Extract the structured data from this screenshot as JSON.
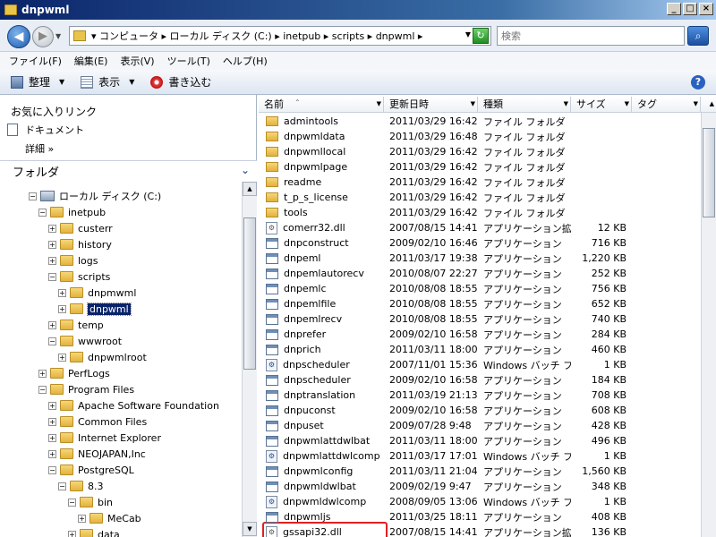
{
  "window": {
    "title": "dnpwml"
  },
  "address": {
    "path": "▾ コンピュータ ▸ ローカル ディスク (C:) ▸ inetpub ▸ scripts ▸ dnpwml ▸",
    "search_placeholder": "検索"
  },
  "menu": [
    "ファイル(F)",
    "編集(E)",
    "表示(V)",
    "ツール(T)",
    "ヘルプ(H)"
  ],
  "toolbar": {
    "organize": "整理",
    "views": "表示",
    "burn": "書き込む"
  },
  "favorites": {
    "title": "お気に入りリンク",
    "documents": "ドキュメント",
    "more": "詳細 »"
  },
  "folders_header": "フォルダ",
  "tree": [
    {
      "label": "ローカル ディスク (C:)",
      "indent": 0,
      "toggle": "−",
      "kind": "drive"
    },
    {
      "label": "inetpub",
      "indent": 1,
      "toggle": "−",
      "kind": "folder"
    },
    {
      "label": "custerr",
      "indent": 2,
      "toggle": "+",
      "kind": "folder"
    },
    {
      "label": "history",
      "indent": 2,
      "toggle": "+",
      "kind": "folder"
    },
    {
      "label": "logs",
      "indent": 2,
      "toggle": "+",
      "kind": "folder"
    },
    {
      "label": "scripts",
      "indent": 2,
      "toggle": "−",
      "kind": "folder"
    },
    {
      "label": "dnpmwml",
      "indent": 3,
      "toggle": "+",
      "kind": "folder"
    },
    {
      "label": "dnpwml",
      "indent": 3,
      "toggle": "+",
      "kind": "folder",
      "selected": true
    },
    {
      "label": "temp",
      "indent": 2,
      "toggle": "+",
      "kind": "folder"
    },
    {
      "label": "wwwroot",
      "indent": 2,
      "toggle": "−",
      "kind": "folder"
    },
    {
      "label": "dnpwmlroot",
      "indent": 3,
      "toggle": "+",
      "kind": "folder"
    },
    {
      "label": "PerfLogs",
      "indent": 1,
      "toggle": "+",
      "kind": "folder"
    },
    {
      "label": "Program Files",
      "indent": 1,
      "toggle": "−",
      "kind": "folder"
    },
    {
      "label": "Apache Software Foundation",
      "indent": 2,
      "toggle": "+",
      "kind": "folder"
    },
    {
      "label": "Common Files",
      "indent": 2,
      "toggle": "+",
      "kind": "folder"
    },
    {
      "label": "Internet Explorer",
      "indent": 2,
      "toggle": "+",
      "kind": "folder"
    },
    {
      "label": "NEOJAPAN,Inc",
      "indent": 2,
      "toggle": "+",
      "kind": "folder"
    },
    {
      "label": "PostgreSQL",
      "indent": 2,
      "toggle": "−",
      "kind": "folder"
    },
    {
      "label": "8.3",
      "indent": 3,
      "toggle": "−",
      "kind": "folder"
    },
    {
      "label": "bin",
      "indent": 4,
      "toggle": "−",
      "kind": "folder"
    },
    {
      "label": "MeCab",
      "indent": 5,
      "toggle": "+",
      "kind": "folder"
    },
    {
      "label": "data",
      "indent": 4,
      "toggle": "+",
      "kind": "folder"
    }
  ],
  "columns": [
    "名前",
    "更新日時",
    "種類",
    "サイズ",
    "タグ"
  ],
  "files": [
    {
      "name": "admintools",
      "date": "2011/03/29 16:42",
      "type": "ファイル フォルダ",
      "size": "",
      "kind": "folder"
    },
    {
      "name": "dnpwmldata",
      "date": "2011/03/29 16:48",
      "type": "ファイル フォルダ",
      "size": "",
      "kind": "folder"
    },
    {
      "name": "dnpwmllocal",
      "date": "2011/03/29 16:42",
      "type": "ファイル フォルダ",
      "size": "",
      "kind": "folder"
    },
    {
      "name": "dnpwmlpage",
      "date": "2011/03/29 16:42",
      "type": "ファイル フォルダ",
      "size": "",
      "kind": "folder"
    },
    {
      "name": "readme",
      "date": "2011/03/29 16:42",
      "type": "ファイル フォルダ",
      "size": "",
      "kind": "folder"
    },
    {
      "name": "t_p_s_license",
      "date": "2011/03/29 16:42",
      "type": "ファイル フォルダ",
      "size": "",
      "kind": "folder"
    },
    {
      "name": "tools",
      "date": "2011/03/29 16:42",
      "type": "ファイル フォルダ",
      "size": "",
      "kind": "folder"
    },
    {
      "name": "comerr32.dll",
      "date": "2007/08/15 14:41",
      "type": "アプリケーション拡張",
      "size": "12 KB",
      "kind": "dll"
    },
    {
      "name": "dnpconstruct",
      "date": "2009/02/10 16:46",
      "type": "アプリケーション",
      "size": "716 KB",
      "kind": "app"
    },
    {
      "name": "dnpeml",
      "date": "2011/03/17 19:38",
      "type": "アプリケーション",
      "size": "1,220 KB",
      "kind": "app"
    },
    {
      "name": "dnpemlautorecv",
      "date": "2010/08/07 22:27",
      "type": "アプリケーション",
      "size": "252 KB",
      "kind": "app"
    },
    {
      "name": "dnpemlc",
      "date": "2010/08/08 18:55",
      "type": "アプリケーション",
      "size": "756 KB",
      "kind": "app"
    },
    {
      "name": "dnpemlfile",
      "date": "2010/08/08 18:55",
      "type": "アプリケーション",
      "size": "652 KB",
      "kind": "app"
    },
    {
      "name": "dnpemlrecv",
      "date": "2010/08/08 18:55",
      "type": "アプリケーション",
      "size": "740 KB",
      "kind": "app"
    },
    {
      "name": "dnprefer",
      "date": "2009/02/10 16:58",
      "type": "アプリケーション",
      "size": "284 KB",
      "kind": "app"
    },
    {
      "name": "dnprich",
      "date": "2011/03/11 18:00",
      "type": "アプリケーション",
      "size": "460 KB",
      "kind": "app"
    },
    {
      "name": "dnpscheduler",
      "date": "2007/11/01 15:36",
      "type": "Windows バッチ フ...",
      "size": "1 KB",
      "kind": "bat"
    },
    {
      "name": "dnpscheduler",
      "date": "2009/02/10 16:58",
      "type": "アプリケーション",
      "size": "184 KB",
      "kind": "app"
    },
    {
      "name": "dnptranslation",
      "date": "2011/03/19 21:13",
      "type": "アプリケーション",
      "size": "708 KB",
      "kind": "app"
    },
    {
      "name": "dnpuconst",
      "date": "2009/02/10 16:58",
      "type": "アプリケーション",
      "size": "608 KB",
      "kind": "app"
    },
    {
      "name": "dnpuset",
      "date": "2009/07/28 9:48",
      "type": "アプリケーション",
      "size": "428 KB",
      "kind": "app"
    },
    {
      "name": "dnpwmlattdwlbat",
      "date": "2011/03/11 18:00",
      "type": "アプリケーション",
      "size": "496 KB",
      "kind": "app"
    },
    {
      "name": "dnpwmlattdwlcomp",
      "date": "2011/03/17 17:01",
      "type": "Windows バッチ フ...",
      "size": "1 KB",
      "kind": "bat"
    },
    {
      "name": "dnpwmlconfig",
      "date": "2011/03/11 21:04",
      "type": "アプリケーション",
      "size": "1,560 KB",
      "kind": "app"
    },
    {
      "name": "dnpwmldwlbat",
      "date": "2009/02/19 9:47",
      "type": "アプリケーション",
      "size": "348 KB",
      "kind": "app"
    },
    {
      "name": "dnpwmldwlcomp",
      "date": "2008/09/05 13:06",
      "type": "Windows バッチ フ...",
      "size": "1 KB",
      "kind": "bat"
    },
    {
      "name": "dnpwmljs",
      "date": "2011/03/25 18:11",
      "type": "アプリケーション",
      "size": "408 KB",
      "kind": "app",
      "highlighted": true
    },
    {
      "name": "gssapi32.dll",
      "date": "2007/08/15 14:41",
      "type": "アプリケーション拡張",
      "size": "136 KB",
      "kind": "dll"
    }
  ]
}
